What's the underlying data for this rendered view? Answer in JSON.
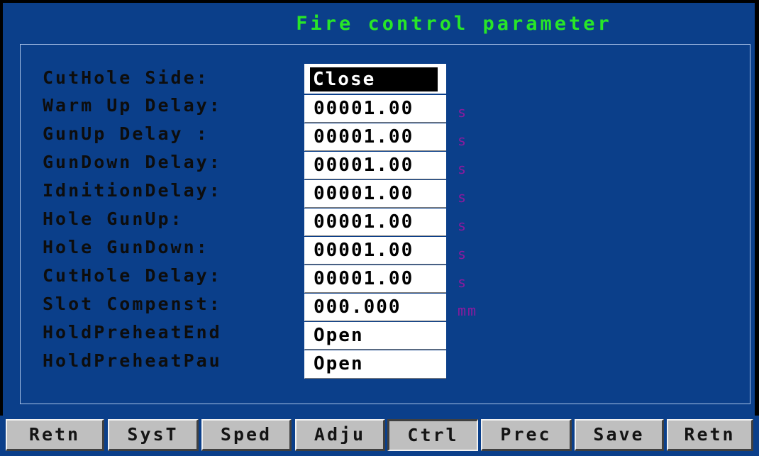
{
  "window": {
    "title": "Fire control parameter"
  },
  "params": [
    {
      "label": "CutHole Side:",
      "value": "Close",
      "unit": ""
    },
    {
      "label": "Warm Up Delay:",
      "value": "00001.00",
      "unit": "s"
    },
    {
      "label": "GunUp Delay :",
      "value": "00001.00",
      "unit": "s"
    },
    {
      "label": "GunDown Delay:",
      "value": "00001.00",
      "unit": "s"
    },
    {
      "label": "IdnitionDelay:",
      "value": "00001.00",
      "unit": "s"
    },
    {
      "label": "Hole GunUp:",
      "value": "00001.00",
      "unit": "s"
    },
    {
      "label": "Hole GunDown:",
      "value": "00001.00",
      "unit": "s"
    },
    {
      "label": "CutHole Delay:",
      "value": "00001.00",
      "unit": "s"
    },
    {
      "label": "Slot Compenst:",
      "value": "000.000",
      "unit": "mm"
    },
    {
      "label": "HoldPreheatEnd",
      "value": "Open",
      "unit": ""
    },
    {
      "label": "HoldPreheatPau",
      "value": "Open",
      "unit": ""
    }
  ],
  "softkeys": [
    {
      "label": "Retn"
    },
    {
      "label": "SysT"
    },
    {
      "label": "Sped"
    },
    {
      "label": "Adju"
    },
    {
      "label": "Ctrl"
    },
    {
      "label": "Prec"
    },
    {
      "label": "Save"
    },
    {
      "label": "Retn"
    }
  ],
  "colors": {
    "background": "#0b3f8a",
    "title": "#28e628",
    "unit": "#8b1a9e",
    "button": "#bfbfbf"
  }
}
